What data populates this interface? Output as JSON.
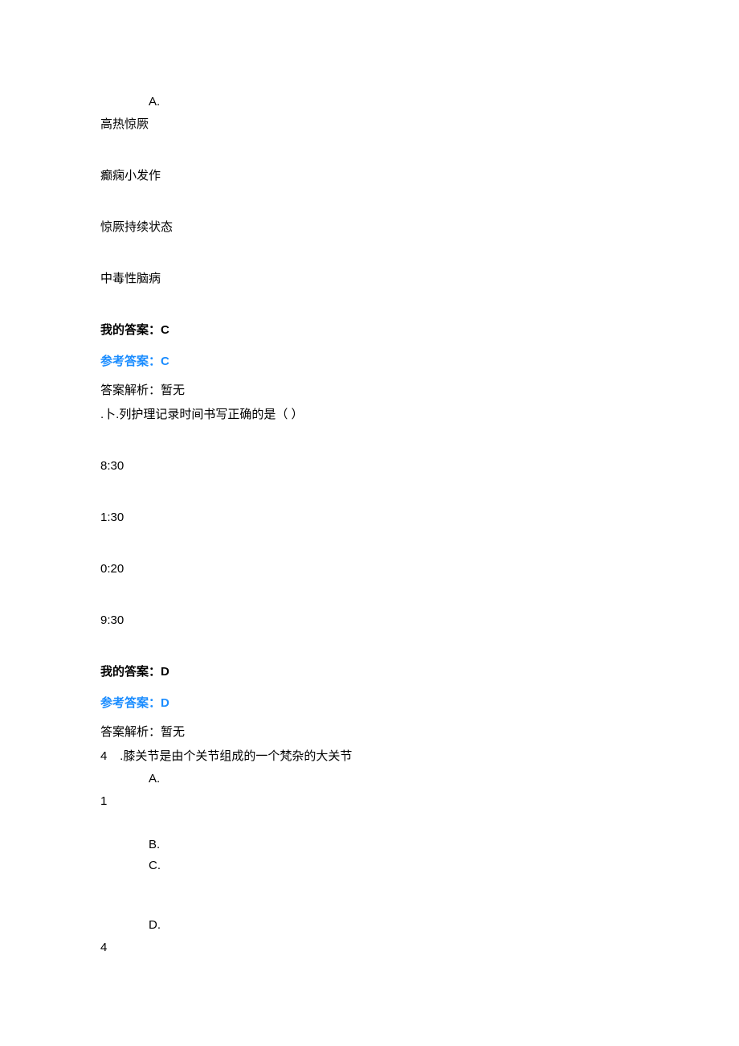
{
  "q2": {
    "letterA": "A.",
    "optA": "高热惊厥",
    "optB": "癫痫小发作",
    "optC": "惊厥持续状态",
    "optD": "中毒性脑病",
    "myAnswerLabel": "我的答案：",
    "myAnswerLetter": "C",
    "refAnswerLabel": "参考答案：",
    "refAnswerLetter": "C",
    "explain": "答案解析：暂无"
  },
  "q3": {
    "stem": ".卜.列护理记录时间书写正确的是（ ）",
    "optA": "8:30",
    "optB": "1:30",
    "optC": "0:20",
    "optD": "9:30",
    "myAnswerLabel": "我的答案：",
    "myAnswerLetter": "D",
    "refAnswerLabel": "参考答案：",
    "refAnswerLetter": "D",
    "explain": "答案解析：暂无"
  },
  "q4": {
    "num": "4",
    "stem": ".膝关节是由个关节组成的一个梵杂的大关节",
    "letterA": "A.",
    "valA": "1",
    "letterB": "B.",
    "letterC": "C.",
    "letterD": "D.",
    "valD": "4"
  }
}
